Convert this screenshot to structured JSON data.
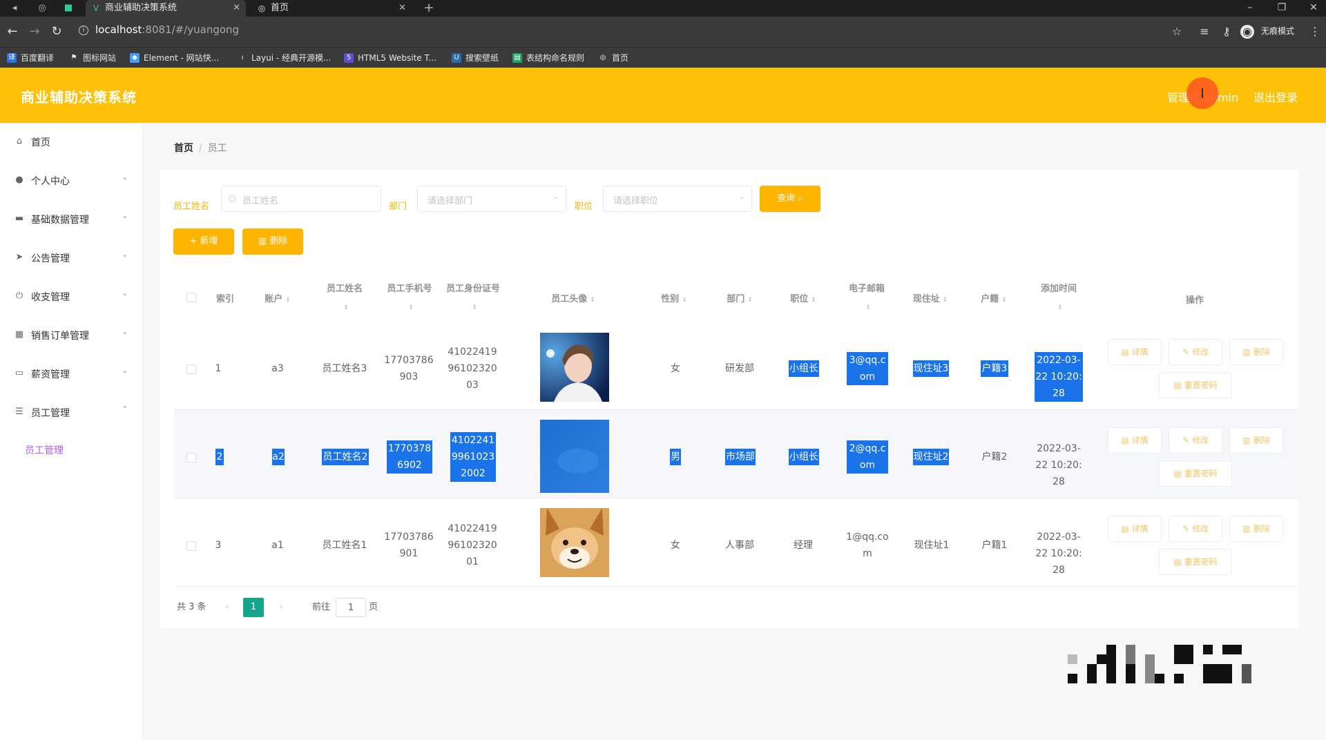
{
  "browser": {
    "tabs": [
      {
        "title": "商业辅助决策系统",
        "active": true
      },
      {
        "title": "首页",
        "active": false
      }
    ],
    "url_host": "localhost",
    "url_path": ":8081/#/yuangong",
    "incognito_label": "无痕模式",
    "bookmarks": [
      "百度翻译",
      "图标网站",
      "Element - 网站快...",
      "Layui - 经典开源模...",
      "HTML5 Website T...",
      "搜索壁纸",
      "表结构命名规则",
      "首页"
    ]
  },
  "header": {
    "app_title": "商业辅助决策系统",
    "user_label": "管理员 admin",
    "logout_label": "退出登录",
    "color": "#ffc107"
  },
  "sidebar": {
    "items": [
      {
        "label": "首页",
        "icon": "home-icon"
      },
      {
        "label": "个人中心",
        "icon": "user-icon"
      },
      {
        "label": "基础数据管理",
        "icon": "monitor-icon"
      },
      {
        "label": "公告管理",
        "icon": "send-icon"
      },
      {
        "label": "收支管理",
        "icon": "power-icon"
      },
      {
        "label": "销售订单管理",
        "icon": "grid-icon"
      },
      {
        "label": "薪资管理",
        "icon": "wallet-icon"
      },
      {
        "label": "员工管理",
        "icon": "list-icon"
      }
    ],
    "submenu_label": "员工管理"
  },
  "breadcrumb": {
    "home": "首页",
    "current": "员工"
  },
  "filters": {
    "name_label": "员工姓名",
    "name_placeholder": "员工姓名",
    "dept_label": "部门",
    "dept_placeholder": "请选择部门",
    "position_label": "职位",
    "position_placeholder": "请选择职位",
    "search_button": "查询"
  },
  "actions": {
    "add_label": "新增",
    "delete_label": "删除"
  },
  "table": {
    "headers": {
      "index": "索引",
      "account": "账户",
      "name": "员工姓名",
      "phone": "员工手机号",
      "idcard": "员工身份证号",
      "avatar": "员工头像",
      "gender": "性别",
      "dept": "部门",
      "position": "职位",
      "email": "电子邮箱",
      "address": "现住址",
      "hukou": "户籍",
      "added": "添加时间",
      "ops": "操作"
    },
    "rows": [
      {
        "index": "1",
        "account": "a3",
        "name": "员工姓名3",
        "phone": "17703786903",
        "idcard": "410224199610232003",
        "gender": "女",
        "dept": "研发部",
        "position": "小组长",
        "email": "3@qq.com",
        "address": "现住址3",
        "hukou": "户籍3",
        "added": "2022-03-22 10:20:28",
        "avatar": "person-photo"
      },
      {
        "index": "2",
        "account": "a2",
        "name": "员工姓名2",
        "phone": "17703786902",
        "idcard": "410224199610232002",
        "gender": "男",
        "dept": "市场部",
        "position": "小组长",
        "email": "2@qq.com",
        "address": "现住址2",
        "hukou": "户籍2",
        "added": "2022-03-22 10:20:28",
        "avatar": "blue-image"
      },
      {
        "index": "3",
        "account": "a1",
        "name": "员工姓名1",
        "phone": "17703786901",
        "idcard": "410224199610232001",
        "gender": "女",
        "dept": "人事部",
        "position": "经理",
        "email": "1@qq.com",
        "address": "现住址1",
        "hukou": "户籍1",
        "added": "2022-03-22 10:20:28",
        "avatar": "dog-photo"
      }
    ],
    "op_labels": {
      "detail": "详情",
      "edit": "修改",
      "delete": "删除",
      "reset": "重置密码"
    }
  },
  "pagination": {
    "total": "共 3 条",
    "current_page": "1",
    "goto_label": "前往",
    "goto_value": "1",
    "page_suffix": "页"
  }
}
